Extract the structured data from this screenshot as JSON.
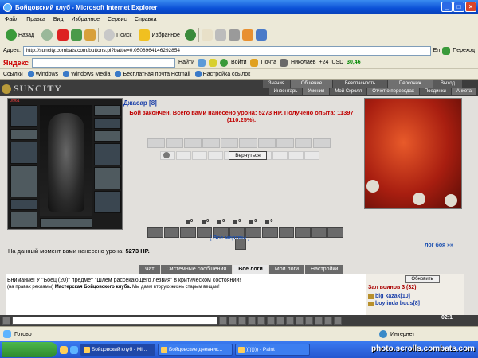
{
  "window": {
    "title": "Бойцовский клуб - Microsoft Internet Explorer"
  },
  "menu": [
    "Файл",
    "Правка",
    "Вид",
    "Избранное",
    "Сервис",
    "Справка"
  ],
  "toolbar": {
    "back": "Назад",
    "search": "Поиск",
    "favorites": "Избранное"
  },
  "address": {
    "label": "Адрес:",
    "url": "http://suncity.combats.com/buttons.pl?battle=0.0508964146292854",
    "lang": "En",
    "go": "Переход"
  },
  "yandex": {
    "brand": "Яндекс",
    "find": "Найти",
    "login": "Войти",
    "mail": "Почта",
    "city": "Николаев",
    "temp": "+24",
    "rate_label": "USD",
    "rate": "30,46"
  },
  "links": {
    "label": "Ссылки",
    "items": [
      "Windows",
      "Windows Media",
      "Бесплатная почта Hotmail",
      "Настройка ссылок"
    ]
  },
  "game": {
    "logo": "SUNCITY",
    "nav_top": [
      "Знания",
      "Общение",
      "Безопасность",
      "Персонаж",
      "Выход"
    ],
    "nav_bottom": [
      "Инвентарь",
      "Умения",
      "Мой Скролл",
      "Отчет о переводах",
      "Поединки",
      "Анкета"
    ],
    "player": "Джасар [8]",
    "hp": "0/961",
    "battle_msg": "Бой закончен. Всего вами нанесено урона: 5273 HP. Получено опыта: 11397 (110.25%).",
    "back_button": "Вернуться",
    "stats": [
      "0",
      "0",
      "0",
      "0",
      "0",
      "0"
    ],
    "all_dead": "[ Все мертвы ]",
    "battle_log": "лог боя »»",
    "damage_line": "На данный момент вами нанесено урона:",
    "damage_value": "5273 HP."
  },
  "tabs": [
    "Чат",
    "Системные сообщения",
    "Все логи",
    "Мои логи",
    "Настройки"
  ],
  "chat": {
    "line1": "Внимание! У \"Боец (20)\" предмет \"Шлем рассекающего лезвия\" в критическом состоянии!",
    "line2_prefix": "(на правах рекламы)",
    "line2_bold": "Мастерская Бойцовского клуба.",
    "line2_rest": "Мы даем вторую жизнь старым вещам!"
  },
  "warroom": {
    "update": "Обновить",
    "title": "Зал воинов 3 (32)",
    "users": [
      "big kazak[10]",
      "boy inda buds[8]"
    ]
  },
  "clock": "02:1",
  "status": {
    "done": "Готово",
    "zone": "Интернет"
  },
  "taskbar": [
    "Бойцовский клуб - Mi...",
    "Бойцовские дневник...",
    "))))))) - Paint"
  ],
  "watermark": "photo.scrolls.combats.com",
  "colors": {
    "title_blue": "#0a4fd6",
    "name_blue": "#1a3fa8",
    "alert_red": "#c00000"
  }
}
